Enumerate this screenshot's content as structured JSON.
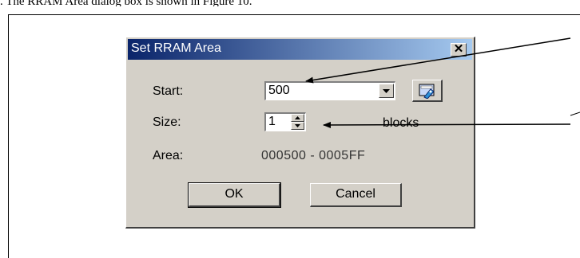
{
  "caption": ". The RRAM Area dialog box is shown in Figure 10.",
  "dialog": {
    "title": "Set RRAM Area",
    "close_symbol": "✕",
    "start_label": "Start:",
    "start_value": "500",
    "size_label": "Size:",
    "size_value": "1",
    "size_unit": "blocks",
    "area_label": "Area:",
    "area_value": "000500 - 0005FF",
    "ok_label": "OK",
    "cancel_label": "Cancel"
  },
  "icons": {
    "combo_arrow": "chevron-down-icon",
    "tool": "memory-chip-icon",
    "spin_up": "triangle-up-icon",
    "spin_down": "triangle-down-icon"
  },
  "colors": {
    "title_start": "#0a246a",
    "title_end": "#a6caf0",
    "face": "#d4d0c8"
  }
}
